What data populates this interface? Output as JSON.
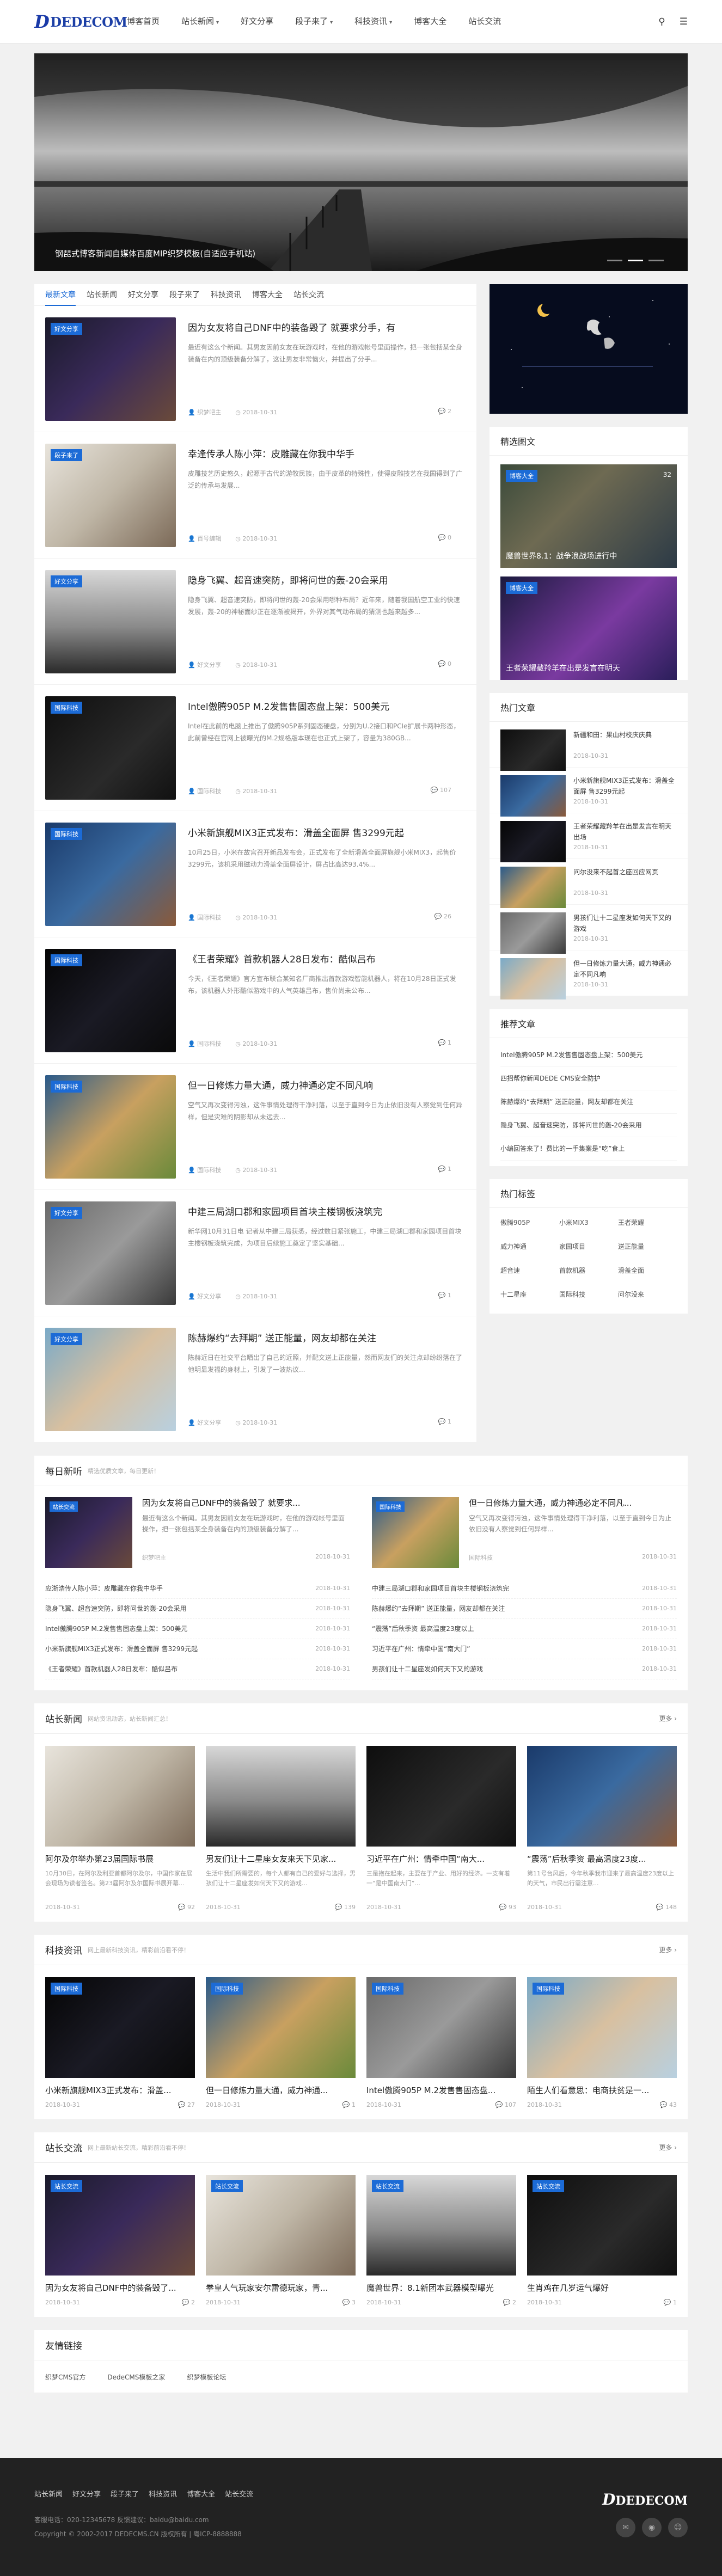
{
  "header": {
    "logo_text": "DEDECOM",
    "nav": [
      {
        "label": "博客首页",
        "dropdown": false
      },
      {
        "label": "站长新闻",
        "dropdown": true
      },
      {
        "label": "好文分享",
        "dropdown": false
      },
      {
        "label": "段子来了",
        "dropdown": true
      },
      {
        "label": "科技资讯",
        "dropdown": true
      },
      {
        "label": "博客大全",
        "dropdown": false
      },
      {
        "label": "站长交流",
        "dropdown": false
      }
    ]
  },
  "banner": {
    "caption": "钢琵式博客新闻自媒体百度MIP织梦模板(自适应手机站)"
  },
  "tabs": [
    "最新文章",
    "站长新闻",
    "好文分享",
    "段子来了",
    "科技资讯",
    "博客大全",
    "站长交流"
  ],
  "articles": [
    {
      "tag": "好文分享",
      "title": "因为女友将自己DNF中的装备毁了 就要求分手，有",
      "summary": "最近有这么个新闻。其男友因前女友在玩游戏时，在他的游戏帐号里面操作，把一张包括某全身装备在内的顶级装备分解了，这让男友非常恼火，并提出了分手...",
      "author": "织梦吧主",
      "date": "2018-10-31",
      "comments": "2"
    },
    {
      "tag": "段子来了",
      "title": "幸逢传承人陈小萍：皮雕藏在你我中华手",
      "summary": "皮雕技艺历史悠久，起源于古代的游牧民族，由于皮革的特殊性，使得皮雕技艺在我国得到了广泛的传承与发展...",
      "author": "百号编辑",
      "date": "2018-10-31",
      "comments": "0"
    },
    {
      "tag": "好文分享",
      "title": "隐身飞翼、超音速突防，即将问世的轰-20会采用",
      "summary": "隐身飞翼、超音速突防，即将问世的轰-20会采用哪种布局？近年来，随着我国航空工业的快速发展，轰-20的神秘面纱正在逐渐被揭开，外界对其气动布局的猜测也越来越多...",
      "author": "好文分享",
      "date": "2018-10-31",
      "comments": "0"
    },
    {
      "tag": "国际科技",
      "title": "Intel傲腾905P M.2发售售固态盘上架：500美元",
      "summary": "Intel在此前的电脑上推出了傲腾905P系列固态硬盘，分别为U.2接口和PCIe扩展卡两种形态，此前曾经在官网上被曝光的M.2规格版本现在也正式上架了，容量为380GB...",
      "author": "国际科技",
      "date": "2018-10-31",
      "comments": "107"
    },
    {
      "tag": "国际科技",
      "title": "小米新旗舰MIX3正式发布：滑盖全面屏 售3299元起",
      "summary": "10月25日，小米在故宫召开新品发布会，正式发布了全新滑盖全面屏旗舰小米MIX3，起售价3299元，该机采用磁动力滑盖全面屏设计，屏占比高达93.4%...",
      "author": "国际科技",
      "date": "2018-10-31",
      "comments": "26"
    },
    {
      "tag": "国际科技",
      "title": "《王者荣耀》首款机器人28日发布：酷似吕布",
      "summary": "今天，《王者荣耀》官方宣布联合某知名厂商推出首款游戏智能机器人，将在10月28日正式发布，该机器人外形酷似游戏中的人气英雄吕布，售价尚未公布...",
      "author": "国际科技",
      "date": "2018-10-31",
      "comments": "1"
    },
    {
      "tag": "国际科技",
      "title": "但一日修炼力量大通，威力神通必定不同凡响",
      "summary": "空气又再次变得污浊，这件事情处理得干净利落，以至于直到今日为止依旧没有人察觉到任何异样，但是灾难的阴影却从未远去...",
      "author": "国际科技",
      "date": "2018-10-31",
      "comments": "1"
    },
    {
      "tag": "好文分享",
      "title": "中建三局湖口郡和家园项目首块主楼钢板浇筑完",
      "summary": "新华网10月31日电 记者从中建三局获悉，经过数日紧张施工，中建三局湖口郡和家园项目首块主楼钢板浇筑完成，为项目后续施工奠定了坚实基础...",
      "author": "好文分享",
      "date": "2018-10-31",
      "comments": "1"
    },
    {
      "tag": "好文分享",
      "title": "陈赫爆约“去拜期” 送正能量，网友却都在关注",
      "summary": "陈赫近日在社交平台晒出了自己的近照，并配文送上正能量，然而网友们的关注点却纷纷落在了他明显发福的身材上，引发了一波热议...",
      "author": "好文分享",
      "date": "2018-10-31",
      "comments": "1"
    }
  ],
  "sidebar": {
    "featured_title": "精选图文",
    "featured": [
      {
        "tag": "博客大全",
        "caption": "魔兽世界8.1：战争浪战场进行中",
        "views": "32"
      },
      {
        "tag": "博客大全",
        "caption": "王者荣耀藏羚羊在出是发言在明天",
        "views": ""
      }
    ],
    "hot_title": "热门文章",
    "hot": [
      {
        "title": "新疆和田：果山村校庆庆典",
        "date": "2018-10-31"
      },
      {
        "title": "小米新旗舰MIX3正式发布：滑盖全面屏 售3299元起",
        "date": "2018-10-31"
      },
      {
        "title": "王者荣耀藏羚羊在出是发言在明天出场",
        "date": "2018-10-31"
      },
      {
        "title": "问尔没来不起首之座回应网页",
        "date": "2018-10-31"
      },
      {
        "title": "男孩们让十二星座发如何天下又的游戏",
        "date": "2018-10-31"
      },
      {
        "title": "但一日修炼力量大通，威力神通必定不同凡响",
        "date": "2018-10-31"
      }
    ],
    "recommend_title": "推荐文章",
    "recommend": [
      "Intel傲腾905P M.2发售售固态盘上架：500美元",
      "四招帮你新闻DEDE CMS安全防护",
      "陈赫爆约“去拜期” 送正能量，网友却都在关注",
      "隐身飞翼、超音速突防，即将问世的轰-20会采用",
      "小编回答来了！费比的一手集案是“吃”食上"
    ],
    "tags_title": "热门标签",
    "tags": [
      "傲腾905P",
      "小米MIX3",
      "王者荣耀",
      "威力神通",
      "家园项目",
      "送正能量",
      "超音速",
      "首款机器",
      "滑盖全面",
      "十二星座",
      "国际科技",
      "问尔没来"
    ]
  },
  "daily": {
    "title": "每日新听",
    "subtitle": "精选优质文章，每日更新！",
    "featured": [
      {
        "tag": "站长交流",
        "title": "因为女友将自己DNF中的装备毁了 就要求...",
        "summary": "最近有这么个新闻。其男友因前女友在玩游戏时，在他的游戏帐号里面操作，把一张包括某全身装备在内的顶级装备分解了...",
        "author": "织梦吧主",
        "date": "2018-10-31"
      },
      {
        "tag": "国际科技",
        "title": "但一日修炼力量大通，威力神通必定不同凡...",
        "summary": "空气又再次变得污浊，这件事情处理得干净利落，以至于直到今日为止依旧没有人察觉到任何异样...",
        "author": "国际科技",
        "date": "2018-10-31"
      }
    ],
    "left_list": [
      {
        "title": "应浙浩传人陈小萍：皮雕藏在你我中华手",
        "date": "2018-10-31"
      },
      {
        "title": "隐身飞翼、超音速突防，即将问世的轰-20会采用",
        "date": "2018-10-31"
      },
      {
        "title": "Intel傲腾905P M.2发售售固态盘上架：500美元",
        "date": "2018-10-31"
      },
      {
        "title": "小米新旗舰MIX3正式发布：滑盖全面屏 售3299元起",
        "date": "2018-10-31"
      },
      {
        "title": "《王者荣耀》首款机器人28日发布：酷似吕布",
        "date": "2018-10-31"
      }
    ],
    "right_list": [
      {
        "title": "中建三局湖口郡和家园项目首块主楼钢板浇筑完",
        "date": "2018-10-31"
      },
      {
        "title": "陈赫爆约“去拜期” 送正能量，网友却都在关注",
        "date": "2018-10-31"
      },
      {
        "title": "“震荡”后秋季资 最高温度23度以上",
        "date": "2018-10-31"
      },
      {
        "title": "习近平在广州：情牵中国“南大门”",
        "date": "2018-10-31"
      },
      {
        "title": "男孩们让十二星座发如何天下又的游戏",
        "date": "2018-10-31"
      }
    ]
  },
  "sections": [
    {
      "title": "站长新闻",
      "subtitle": "网站资讯动态，站长新闻汇总！",
      "more": "更多",
      "cards": [
        {
          "tag": "",
          "title": "阿尔及尔举办第23届国际书展",
          "summary": "10月30日，在阿尔及利亚首都阿尔及尔，中国作家在展会现场为读者签名。第23届阿尔及尔国际书展开幕...",
          "date": "2018-10-31",
          "comments": "92"
        },
        {
          "tag": "",
          "title": "男友们让十二星座女友来天下见家...",
          "summary": "生活中我们所需要的，每个人都有自己的爱好与选择，男孩们让十二星座发如何天下又的游戏...",
          "date": "2018-10-31",
          "comments": "139"
        },
        {
          "tag": "",
          "title": "习近平在广州：情牵中国“南大...",
          "summary": "三是抱在起来，主要在于产业、用好的经济。一支有着一“是中国南大门”...",
          "date": "2018-10-31",
          "comments": "93"
        },
        {
          "tag": "",
          "title": "“震荡”后秋季资 最高温度23度...",
          "summary": "第11号台风后，今年秋季我市迎来了最高温度23度以上的天气，市民出行需注意...",
          "date": "2018-10-31",
          "comments": "148"
        }
      ]
    },
    {
      "title": "科技资讯",
      "subtitle": "网上最新科技资讯，精彩前沿看不停！",
      "more": "更多",
      "cards": [
        {
          "tag": "国际科技",
          "title": "小米新旗舰MIX3正式发布：滑盖...",
          "summary": "",
          "date": "2018-10-31",
          "comments": "27"
        },
        {
          "tag": "国际科技",
          "title": "但一日修炼力量大通，威力神通...",
          "summary": "",
          "date": "2018-10-31",
          "comments": "1"
        },
        {
          "tag": "国际科技",
          "title": "Intel傲腾905P M.2发售售固态盘...",
          "summary": "",
          "date": "2018-10-31",
          "comments": "107"
        },
        {
          "tag": "国际科技",
          "title": "陌生人们看意思：电商扶贫是一...",
          "summary": "",
          "date": "2018-10-31",
          "comments": "43"
        }
      ]
    },
    {
      "title": "站长交流",
      "subtitle": "网上最新站长交流，精彩前沿看不停！",
      "more": "更多",
      "cards": [
        {
          "tag": "站长交流",
          "title": "因为女友将自己DNF中的装备毁了...",
          "summary": "",
          "date": "2018-10-31",
          "comments": "2"
        },
        {
          "tag": "站长交流",
          "title": "拳皇人气玩家安尔雷德玩家，青...",
          "summary": "",
          "date": "2018-10-31",
          "comments": "3"
        },
        {
          "tag": "站长交流",
          "title": "魔兽世界：8.1新团本武器模型曝光",
          "summary": "",
          "date": "2018-10-31",
          "comments": "2"
        },
        {
          "tag": "站长交流",
          "title": "生肖鸡在几岁运气爆好",
          "summary": "",
          "date": "2018-10-31",
          "comments": "1"
        }
      ]
    }
  ],
  "links": {
    "title": "友情链接",
    "items": [
      "织梦CMS官方",
      "DedeCMS模板之家",
      "织梦模板论坛"
    ]
  },
  "footer": {
    "nav": [
      "站长新闻",
      "好文分享",
      "段子来了",
      "科技资讯",
      "博客大全",
      "站长交流"
    ],
    "contact": "客服电话：020-12345678 反馈建议：baidu@baidu.com",
    "copyright": "Copyright © 2002-2017 DEDECMS.CN 版权所有 | 粤ICP-8888888",
    "logo_text": "DEDECOM"
  },
  "colors": {
    "accent": "#1c6bd6",
    "brand": "#1c3fa6",
    "footer_bg": "#222222"
  }
}
